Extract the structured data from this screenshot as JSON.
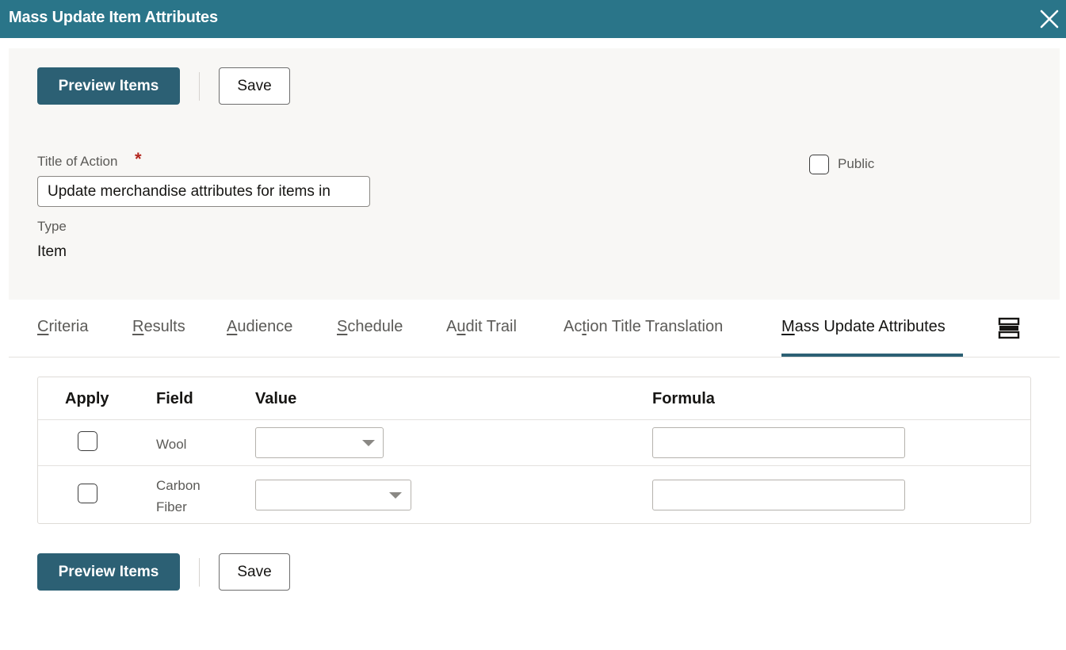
{
  "dialog": {
    "title": "Mass Update Item Attributes",
    "close_icon": "close-icon"
  },
  "toolbar": {
    "preview_label": "Preview Items",
    "save_label": "Save"
  },
  "form": {
    "title_label": "Title of Action",
    "required_marker": "*",
    "title_value": "Update merchandise attributes for items in",
    "public_label": "Public",
    "public_checked": false,
    "type_label": "Type",
    "type_value": "Item"
  },
  "tabs": [
    {
      "label": "Criteria",
      "key": "C",
      "rest": "riteria",
      "active": false
    },
    {
      "label": "Results",
      "key": "R",
      "rest": "esults",
      "active": false
    },
    {
      "label": "Audience",
      "key": "A",
      "rest": "udience",
      "active": false
    },
    {
      "label": "Schedule",
      "key": "S",
      "rest": "chedule",
      "active": false
    },
    {
      "label": "Audit Trail",
      "pre": "A",
      "key": "u",
      "rest": "dit Trail",
      "active": false
    },
    {
      "label": "Action Title Translation",
      "pre": "Ac",
      "key": "t",
      "rest": "ion Title Translation",
      "active": false
    },
    {
      "label": "Mass Update Attributes",
      "key": "M",
      "rest": "ass Update Attributes",
      "active": true
    }
  ],
  "tab_overflow_icon": "hamburger-menu-icon",
  "table": {
    "headers": {
      "apply": "Apply",
      "field": "Field",
      "value": "Value",
      "formula": "Formula"
    },
    "rows": [
      {
        "apply": false,
        "field": "Wool",
        "value": "",
        "formula": ""
      },
      {
        "apply": false,
        "field_line1": "Carbon",
        "field_line2": "Fiber",
        "field": "Carbon Fiber",
        "value": "",
        "formula": ""
      }
    ]
  },
  "colors": {
    "header_bar": "#2a7589",
    "primary_button": "#2c6074",
    "required": "#b3261e",
    "panel": "#f8f7f5"
  }
}
